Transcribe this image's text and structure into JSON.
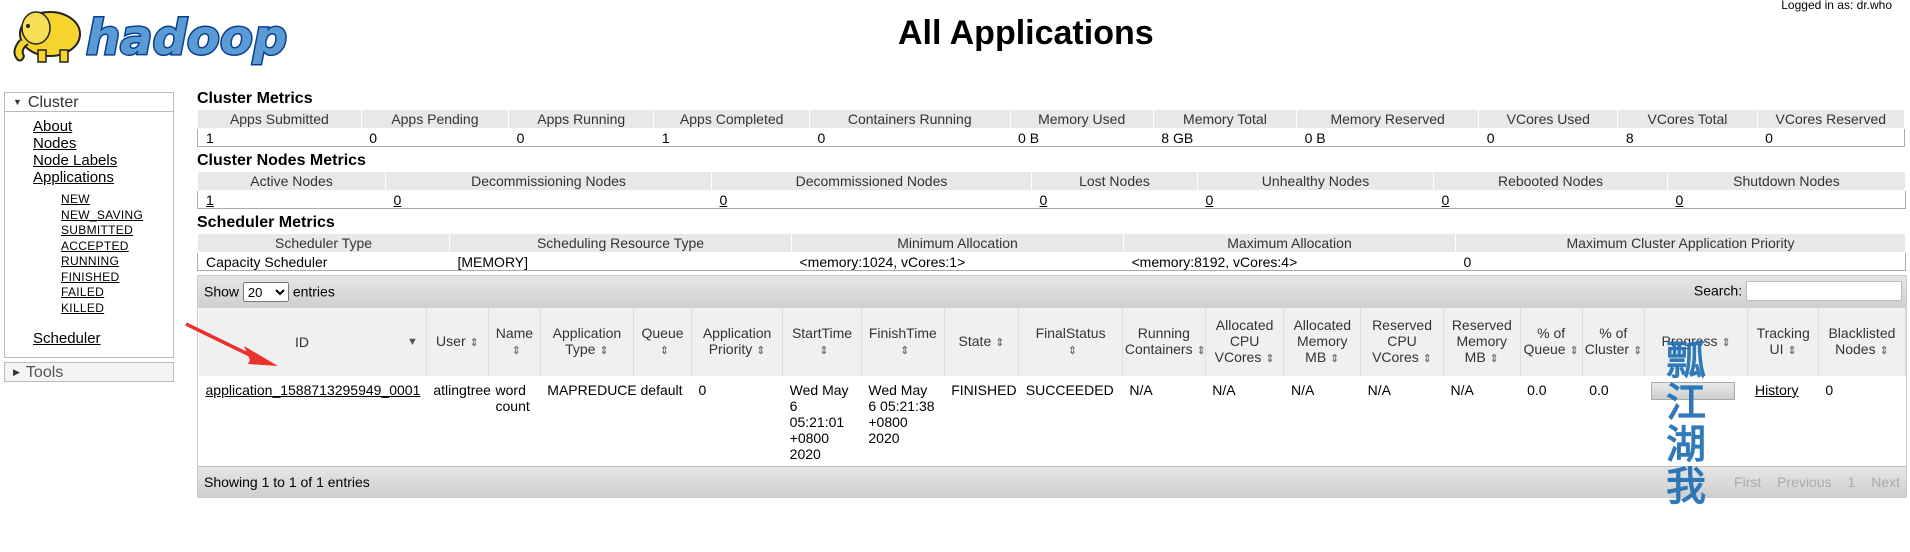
{
  "header": {
    "title": "All Applications",
    "logged_in": "Logged in as: dr.who",
    "logo_text": "hadoop"
  },
  "sidebar": {
    "cluster_label": "Cluster",
    "tools_label": "Tools",
    "items": [
      "About",
      "Nodes",
      "Node Labels",
      "Applications"
    ],
    "app_states": [
      "NEW",
      "NEW_SAVING",
      "SUBMITTED",
      "ACCEPTED",
      "RUNNING",
      "FINISHED",
      "FAILED",
      "KILLED"
    ],
    "scheduler": "Scheduler"
  },
  "cluster_metrics": {
    "title": "Cluster Metrics",
    "headers": [
      "Apps Submitted",
      "Apps Pending",
      "Apps Running",
      "Apps Completed",
      "Containers Running",
      "Memory Used",
      "Memory Total",
      "Memory Reserved",
      "VCores Used",
      "VCores Total",
      "VCores Reserved"
    ],
    "values": [
      "1",
      "0",
      "0",
      "1",
      "0",
      "0 B",
      "8 GB",
      "0 B",
      "0",
      "8",
      "0"
    ]
  },
  "node_metrics": {
    "title": "Cluster Nodes Metrics",
    "headers": [
      "Active Nodes",
      "Decommissioning Nodes",
      "Decommissioned Nodes",
      "Lost Nodes",
      "Unhealthy Nodes",
      "Rebooted Nodes",
      "Shutdown Nodes"
    ],
    "values": [
      "1",
      "0",
      "0",
      "0",
      "0",
      "0",
      "0"
    ]
  },
  "scheduler_metrics": {
    "title": "Scheduler Metrics",
    "headers": [
      "Scheduler Type",
      "Scheduling Resource Type",
      "Minimum Allocation",
      "Maximum Allocation",
      "Maximum Cluster Application Priority"
    ],
    "values": [
      "Capacity Scheduler",
      "[MEMORY]",
      "<memory:1024, vCores:1>",
      "<memory:8192, vCores:4>",
      "0"
    ]
  },
  "apps_table": {
    "show_label": "Show",
    "entries_label": "entries",
    "page_size": "20",
    "search_label": "Search:",
    "headers": [
      "ID",
      "User",
      "Name",
      "Application Type",
      "Queue",
      "Application Priority",
      "StartTime",
      "FinishTime",
      "State",
      "FinalStatus",
      "Running Containers",
      "Allocated CPU VCores",
      "Allocated Memory MB",
      "Reserved CPU VCores",
      "Reserved Memory MB",
      "% of Queue",
      "% of Cluster",
      "Progress",
      "Tracking UI",
      "Blacklisted Nodes"
    ],
    "row": {
      "id": "application_1588713295949_0001",
      "user": "atlingtree",
      "name": "word count",
      "type": "MAPREDUCE",
      "queue": "default",
      "priority": "0",
      "start": "Wed May 6 05:21:01 +0800 2020",
      "finish": "Wed May 6 05:21:38 +0800 2020",
      "state": "FINISHED",
      "final_status": "SUCCEEDED",
      "running_containers": "N/A",
      "alloc_vcores": "N/A",
      "alloc_mem": "N/A",
      "res_vcores": "N/A",
      "res_mem": "N/A",
      "pct_queue": "0.0",
      "pct_cluster": "0.0",
      "progress": 0,
      "tracking": "History",
      "blacklisted": "0"
    },
    "info": "Showing 1 to 1 of 1 entries",
    "pagination": {
      "first": "First",
      "previous": "Previous",
      "page": "1",
      "next": "Next"
    }
  },
  "watermark": "瓢江湖我",
  "colors": {
    "arrow": "#e8322b",
    "watermark": "#1f6fb5",
    "logo_blue": "#0b3f91",
    "logo_yellow": "#f5d52b"
  }
}
